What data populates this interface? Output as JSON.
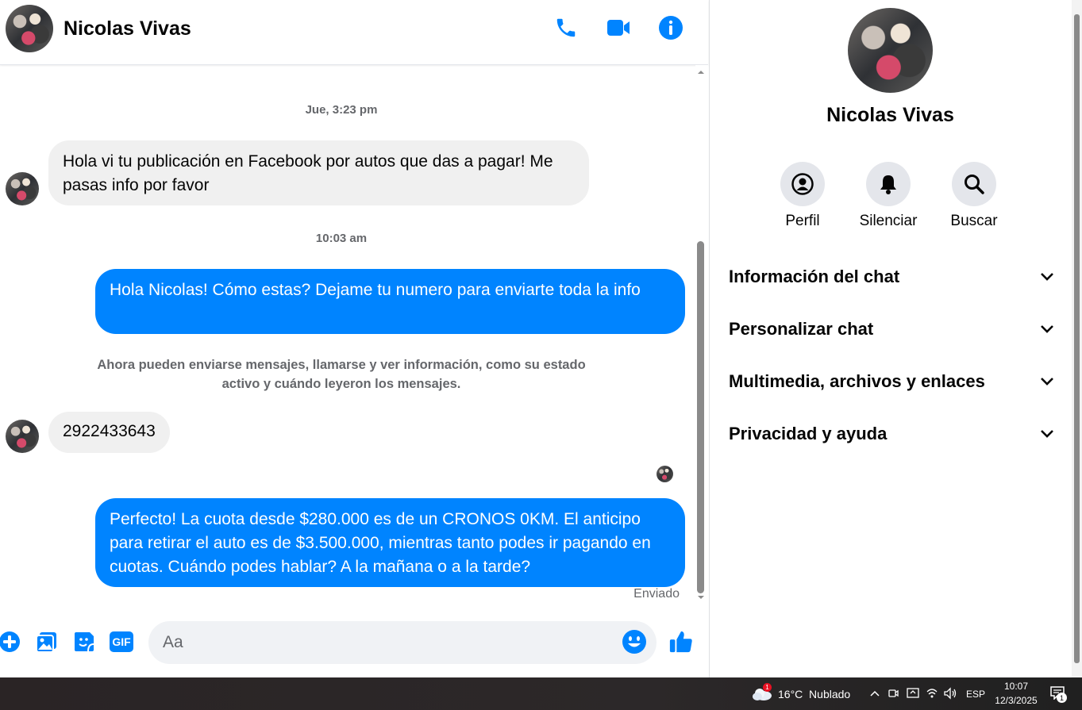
{
  "chat": {
    "contact_name": "Nicolas Vivas",
    "header_icons": [
      "phone-icon",
      "video-call-icon",
      "info-icon"
    ]
  },
  "messages": {
    "ts1": "Jue, 3:23 pm",
    "msg1": "Hola vi tu publicación en Facebook por autos que das a pagar! Me pasas info por favor",
    "ts2": "10:03 am",
    "msg2": "Hola Nicolas! Cómo estas? Dejame tu numero para enviarte toda la info",
    "notice": "Ahora pueden enviarse mensajes, llamarse y ver información, como su estado activo y cuándo leyeron los mensajes.",
    "msg3": "2922433643",
    "msg4": "Perfecto! La cuota desde $280.000 es de un CRONOS 0KM. El anticipo para retirar el auto es de $3.500.000, mientras tanto podes ir pagando en cuotas. Cuándo podes hablar? A la mañana o a la tarde?",
    "status": "Enviado"
  },
  "composer": {
    "placeholder": "Aa",
    "icons": [
      "plus-icon",
      "image-icon",
      "sticker-icon",
      "gif-icon",
      "emoji-icon",
      "thumbs-up-icon"
    ],
    "gif_label": "GIF"
  },
  "panel": {
    "name": "Nicolas Vivas",
    "actions": {
      "profile": "Perfil",
      "mute": "Silenciar",
      "search": "Buscar"
    },
    "sections": {
      "chat_info": "Información del chat",
      "customize": "Personalizar chat",
      "media": "Multimedia, archivos y enlaces",
      "privacy": "Privacidad y ayuda"
    }
  },
  "taskbar": {
    "weather": "16°C  Nublado",
    "weather_badge": "1",
    "lang": "ESP",
    "time": "10:07",
    "date": "12/3/2025",
    "notif_badge": "1"
  },
  "colors": {
    "accent": "#0084ff",
    "incoming": "#f0f0f0",
    "muted_text": "#65676b"
  }
}
